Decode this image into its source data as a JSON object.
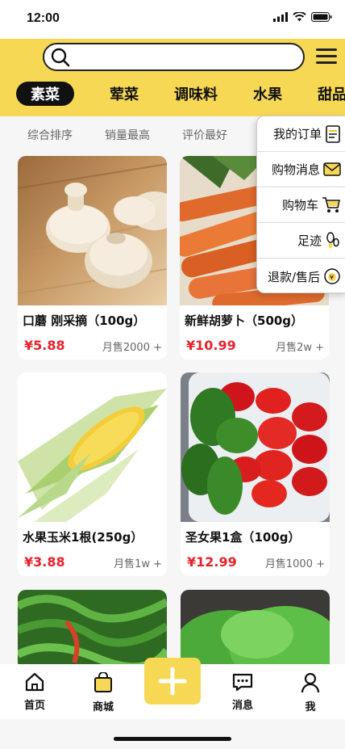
{
  "status": {
    "time": "12:00"
  },
  "search": {
    "placeholder": ""
  },
  "categories": [
    "素菜",
    "荤菜",
    "调味料",
    "水果",
    "甜品"
  ],
  "active_category": "素菜",
  "sort_options": [
    "综合排序",
    "销量最高",
    "评价最好"
  ],
  "products": [
    {
      "title": "口蘑 刚采摘（100g）",
      "price": "¥5.88",
      "sales": "月售2000 +"
    },
    {
      "title": "新鲜胡萝卜（500g）",
      "price": "¥10.99",
      "sales": "月售2w +"
    },
    {
      "title": "水果玉米1根(250g）",
      "price": "¥3.88",
      "sales": "月售1w +"
    },
    {
      "title": "圣女果1盒（100g）",
      "price": "¥12.99",
      "sales": "月售1000 +"
    }
  ],
  "dropdown": [
    {
      "label": "我的订单",
      "icon": "order-list-icon"
    },
    {
      "label": "购物消息",
      "icon": "mail-icon"
    },
    {
      "label": "购物车",
      "icon": "cart-icon"
    },
    {
      "label": "足迹",
      "icon": "footprint-icon"
    },
    {
      "label": "退款/售后",
      "icon": "refund-icon"
    }
  ],
  "tabbar": {
    "home": "首页",
    "mall": "商城",
    "messages": "消息",
    "me": "我"
  },
  "colors": {
    "accent": "#f7d855",
    "price": "#e8212b"
  }
}
